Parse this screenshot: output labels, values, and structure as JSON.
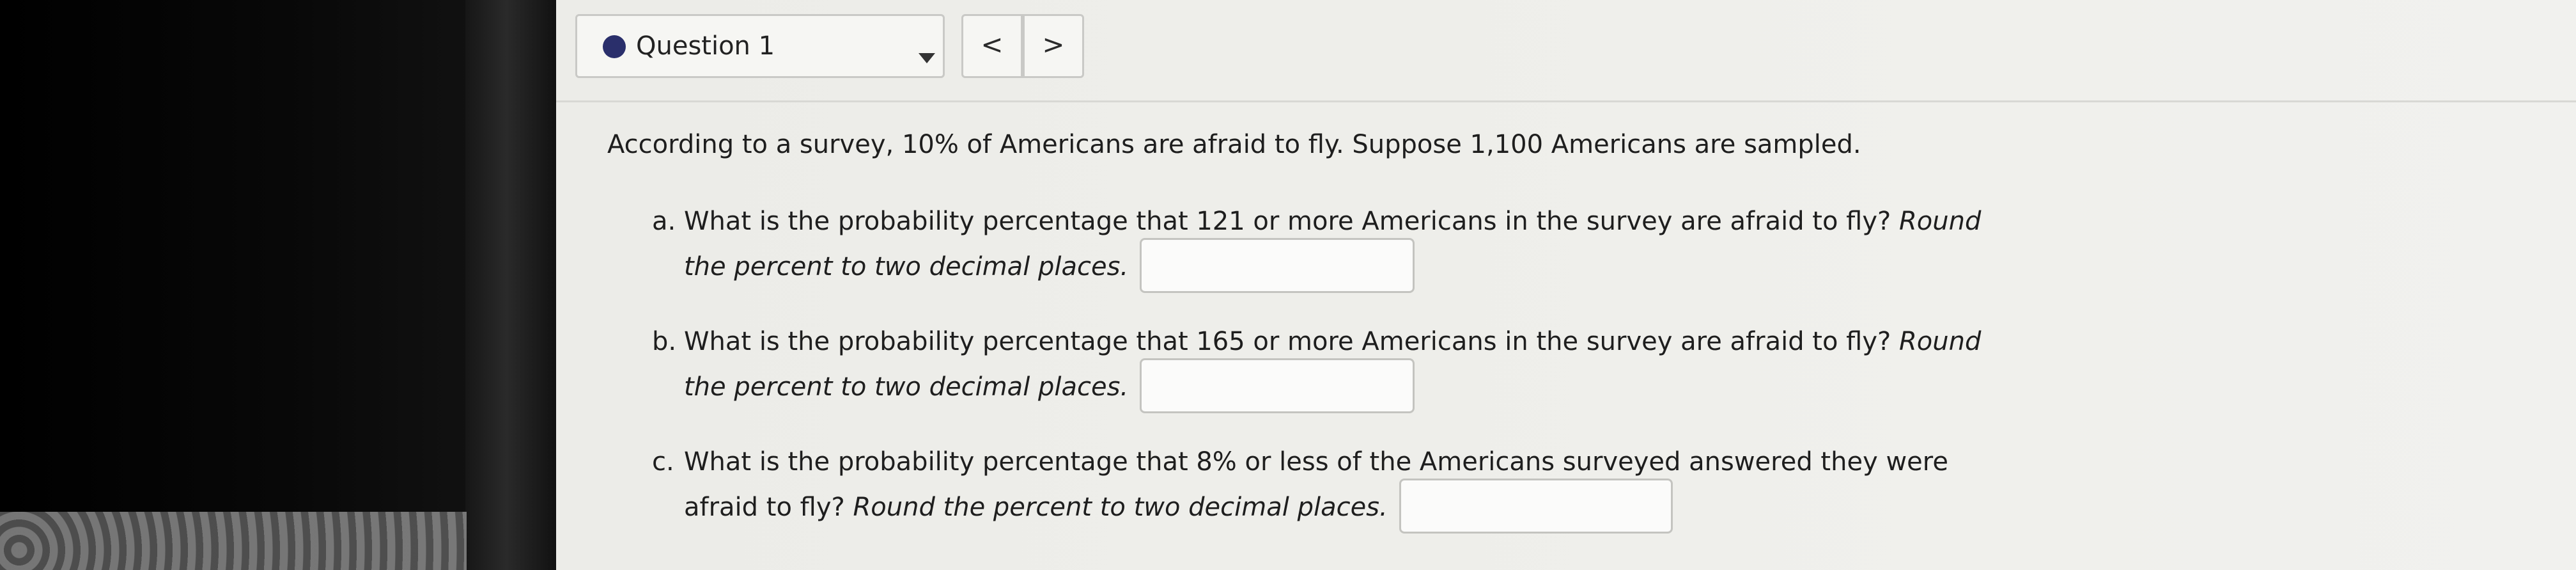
{
  "question_selector": {
    "label": "Question 1"
  },
  "navigation": {
    "prev": "<",
    "next": ">"
  },
  "problem": {
    "intro": "According to a survey, 10% of Americans are afraid to fly. Suppose 1,100 Americans are sampled.",
    "parts": [
      {
        "letter": "a.",
        "text_line1": "What is the probability percentage that 121 or more Americans in the survey are afraid to fly?",
        "italic_line1": "Round",
        "italic_line2": "the percent to two decimal places.",
        "answer": ""
      },
      {
        "letter": "b.",
        "text_line1": "What is the probability percentage that 165 or more Americans in the survey are afraid to fly?",
        "italic_line1": "Round",
        "italic_line2": "the percent to two decimal places.",
        "answer": ""
      },
      {
        "letter": "c.",
        "text_line1": "What is the probability percentage that 8% or less of the Americans surveyed answered they were",
        "text_line2": "afraid to fly?",
        "italic_line2": "Round the percent to two decimal places.",
        "answer": ""
      }
    ]
  },
  "colors": {
    "status_dot": "#2a2f6b",
    "screen_bg": "#efefeb"
  }
}
